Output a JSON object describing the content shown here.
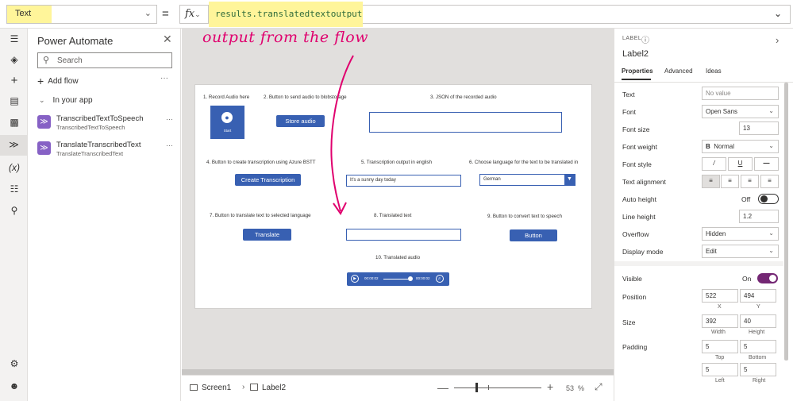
{
  "formula_bar": {
    "property": "Text",
    "equals": "=",
    "fx": "fx",
    "formula": "results.translatedtextoutput"
  },
  "left_rail": {
    "icons": [
      "hamburger-icon",
      "layers-icon",
      "insert-icon",
      "data-icon",
      "media-icon",
      "power-automate-icon",
      "variables-icon",
      "tools-icon",
      "search-icon",
      "settings-icon",
      "account-icon"
    ]
  },
  "side_panel": {
    "title": "Power Automate",
    "search_placeholder": "Search",
    "add_flow": "Add flow",
    "section": "In your app",
    "flows": [
      {
        "name": "TranscribedTextToSpeech",
        "sub": "TranscribedTextToSpeech"
      },
      {
        "name": "TranslateTranscribedText",
        "sub": "TranslateTranscribedText"
      }
    ]
  },
  "annotation": "output from the flow",
  "canvas": {
    "cap1": "1. Record Audio here",
    "mic_label": "Start",
    "cap2": "2. Button to send audio to blobstorage",
    "store_audio": "Store audio",
    "cap3": "3. JSON of the recorded audio",
    "cap4": "4. Button to create transcription using Azure BSTT",
    "create_transcription": "Create Transcription",
    "cap5": "5. Transcription output in english",
    "transcription_value": "It's a sunny day today",
    "cap6": "6. Choose language for the text to be translated in",
    "language": "German",
    "cap7": "7. Button to translate text to selected language",
    "translate": "Translate",
    "cap8": "8. Translated text",
    "cap9": "9. Button to convert text to speech",
    "button": "Button",
    "cap10": "10. Translated audio",
    "audio_elapsed": "00:00:02",
    "audio_total": "00:00:02"
  },
  "bottom_bar": {
    "screen": "Screen1",
    "selected": "Label2",
    "zoom": "53",
    "zoom_unit": "%"
  },
  "properties": {
    "type": "LABEL",
    "name": "Label2",
    "tabs": [
      "Properties",
      "Advanced",
      "Ideas"
    ],
    "text_label": "Text",
    "text_placeholder": "No value",
    "font_label": "Font",
    "font_value": "Open Sans",
    "font_size_label": "Font size",
    "font_size_value": "13",
    "font_weight_label": "Font weight",
    "font_weight_value": "Normal",
    "font_weight_glyph": "B",
    "font_style_label": "Font style",
    "text_align_label": "Text alignment",
    "auto_height_label": "Auto height",
    "auto_height_value": "Off",
    "line_height_label": "Line height",
    "line_height_value": "1.2",
    "overflow_label": "Overflow",
    "overflow_value": "Hidden",
    "display_mode_label": "Display mode",
    "display_mode_value": "Edit",
    "visible_label": "Visible",
    "visible_value": "On",
    "position_label": "Position",
    "pos_x": "522",
    "pos_y": "494",
    "x_cap": "X",
    "y_cap": "Y",
    "size_label": "Size",
    "width": "392",
    "height": "40",
    "width_cap": "Width",
    "height_cap": "Height",
    "padding_label": "Padding",
    "pad_top": "5",
    "pad_bottom": "5",
    "pad_left": "5",
    "pad_right": "5",
    "top_cap": "Top",
    "bottom_cap": "Bottom",
    "left_cap": "Left",
    "right_cap": "Right"
  },
  "colors": {
    "accent": "#3860b2",
    "highlight": "#fff59a",
    "annotation": "#e0006e",
    "toggle_on": "#742774"
  }
}
